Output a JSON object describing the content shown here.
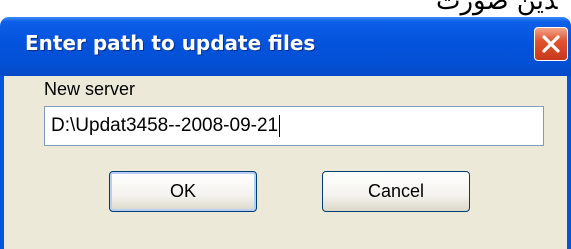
{
  "background": {
    "text": "ﺪﯾﻦ ﺻﻮرت"
  },
  "dialog": {
    "title": "Enter path to update files",
    "field_label": "New server",
    "field_value": "D:\\Updat3458--2008-09-21",
    "ok_label": "OK",
    "cancel_label": "Cancel",
    "close_icon": "close-icon"
  },
  "colors": {
    "titlebar": "#0453dc",
    "close_button": "#e0552f",
    "body": "#ece9d8",
    "input_border": "#7f9db9",
    "button_border": "#003c74"
  }
}
